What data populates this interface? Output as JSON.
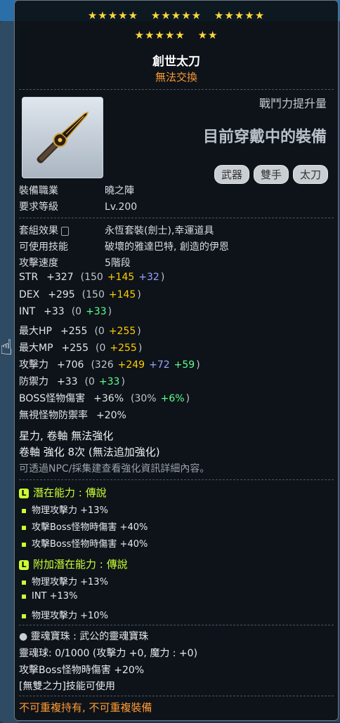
{
  "header": {
    "star_groups_row1": [
      "★★★★★",
      "★★★★★",
      "★★★★★"
    ],
    "star_groups_row2": [
      "★★★★★",
      "★★"
    ],
    "item_name": "創世太刀",
    "trade_status": "無法交換"
  },
  "side": {
    "power_label": "戰鬥力提升量",
    "equipped_label": "目前穿戴中的裝備",
    "tags": [
      "武器",
      "雙手",
      "太刀"
    ]
  },
  "requirements": {
    "job_label": "裝備職業",
    "job_value": "曉之陣",
    "level_label": "要求等級",
    "level_value": "Lv.200"
  },
  "attributes": {
    "set_label": "套組效果",
    "set_value": "永恆套裝(劍士),幸運道具",
    "skill_label": "可使用技能",
    "skill_value": "破壞的雅達巴特, 創造的伊恩",
    "speed_label": "攻擊速度",
    "speed_value": "5階段"
  },
  "stats": [
    {
      "label": "STR",
      "total": "+327",
      "base": "(150",
      "y": "+145",
      "b": "+32",
      "g": "",
      "end": ")"
    },
    {
      "label": "DEX",
      "total": "+295",
      "base": "(150",
      "y": "+145",
      "b": "",
      "g": "",
      "end": ")"
    },
    {
      "label": "INT",
      "total": "+33",
      "base": "(0",
      "y": "",
      "b": "",
      "g": "+33",
      "end": ")"
    },
    {
      "label": "最大HP",
      "total": "+255",
      "base": "(0",
      "y": "+255",
      "b": "",
      "g": "",
      "end": ")"
    },
    {
      "label": "最大MP",
      "total": "+255",
      "base": "(0",
      "y": "+255",
      "b": "",
      "g": "",
      "end": ")"
    },
    {
      "label": "攻擊力",
      "total": "+706",
      "base": "(326",
      "y": "+249",
      "b": "+72",
      "g": "+59",
      "end": ")"
    },
    {
      "label": "防禦力",
      "total": "+33",
      "base": "(0",
      "y": "",
      "b": "",
      "g": "+33",
      "end": ")"
    },
    {
      "label": "BOSS怪物傷害",
      "total": "+36%",
      "base": "(30%",
      "y": "",
      "b": "",
      "g": "+6%",
      "end": ")"
    },
    {
      "label": "無視怪物防禦率",
      "total": "+20%",
      "base": "",
      "y": "",
      "b": "",
      "g": "",
      "end": ""
    }
  ],
  "upgrade": {
    "line1": "星力, 卷軸 無法強化",
    "line2": "卷軸 強化 8次 (無法追加強化)",
    "notice": "可透過NPC/採集建查看強化資訊詳細內容。"
  },
  "potential": {
    "title": "潛在能力 : 傳說",
    "lines": [
      "物理攻擊力 +13%",
      "攻擊Boss怪物時傷害 +40%",
      "攻擊Boss怪物時傷害 +40%"
    ]
  },
  "bonus_potential": {
    "title": "附加潛在能力 : 傳說",
    "lines": [
      "物理攻擊力 +13%",
      "INT +13%",
      "物理攻擊力 +10%"
    ]
  },
  "soul": {
    "title": "靈魂寶珠 : 武公的靈魂寶珠",
    "charge": "靈魂球: 0/1000 (攻擊力 +0, 魔力 : +0)",
    "effect": "攻擊Boss怪物時傷害 +20%",
    "skill": "[無雙之力]技能可使用"
  },
  "warning": "不可重複持有, 不可重複裝備",
  "colors": {
    "star": "#ffd83a",
    "legend_green": "#ccff33",
    "orange": "#ff9933"
  }
}
